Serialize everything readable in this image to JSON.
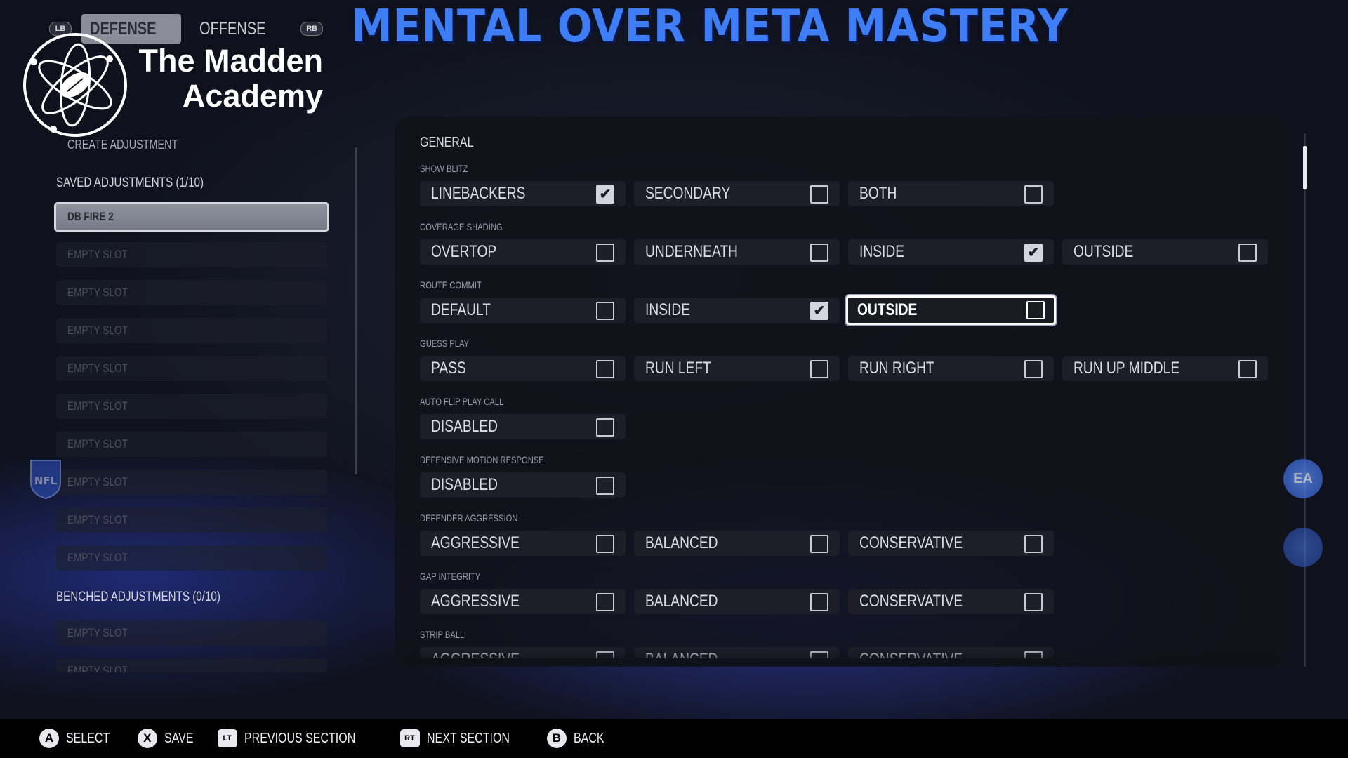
{
  "banner": "MENTAL OVER META MASTERY",
  "tabs": {
    "lb": "LB",
    "defense": "DEFENSE",
    "offense": "OFFENSE",
    "rb": "RB"
  },
  "brand": {
    "line1": "The Madden",
    "line2": "Academy"
  },
  "left": {
    "create": "CREATE ADJUSTMENT",
    "saved_title": "SAVED ADJUSTMENTS (1/10)",
    "saved": [
      "DB FIRE 2",
      "EMPTY SLOT",
      "EMPTY SLOT",
      "EMPTY SLOT",
      "EMPTY SLOT",
      "EMPTY SLOT",
      "EMPTY SLOT",
      "EMPTY SLOT",
      "EMPTY SLOT",
      "EMPTY SLOT"
    ],
    "benched_title": "BENCHED ADJUSTMENTS (0/10)",
    "benched": [
      "EMPTY SLOT",
      "EMPTY SLOT"
    ]
  },
  "main": {
    "section": "GENERAL",
    "groups": [
      {
        "title": "SHOW BLITZ",
        "options": [
          {
            "label": "LINEBACKERS",
            "checked": true
          },
          {
            "label": "SECONDARY",
            "checked": false
          },
          {
            "label": "BOTH",
            "checked": false
          }
        ]
      },
      {
        "title": "COVERAGE SHADING",
        "options": [
          {
            "label": "OVERTOP",
            "checked": false
          },
          {
            "label": "UNDERNEATH",
            "checked": false
          },
          {
            "label": "INSIDE",
            "checked": true
          },
          {
            "label": "OUTSIDE",
            "checked": false
          }
        ]
      },
      {
        "title": "ROUTE COMMIT",
        "options": [
          {
            "label": "DEFAULT",
            "checked": false
          },
          {
            "label": "INSIDE",
            "checked": true
          },
          {
            "label": "OUTSIDE",
            "checked": false,
            "focused": true
          }
        ]
      },
      {
        "title": "GUESS PLAY",
        "options": [
          {
            "label": "PASS",
            "checked": false
          },
          {
            "label": "RUN LEFT",
            "checked": false
          },
          {
            "label": "RUN RIGHT",
            "checked": false
          },
          {
            "label": "RUN UP MIDDLE",
            "checked": false
          }
        ]
      },
      {
        "title": "AUTO FLIP PLAY CALL",
        "options": [
          {
            "label": "DISABLED",
            "checked": false
          }
        ]
      },
      {
        "title": "DEFENSIVE MOTION RESPONSE",
        "options": [
          {
            "label": "DISABLED",
            "checked": false
          }
        ]
      },
      {
        "title": "DEFENDER AGGRESSION",
        "options": [
          {
            "label": "AGGRESSIVE",
            "checked": false
          },
          {
            "label": "BALANCED",
            "checked": false
          },
          {
            "label": "CONSERVATIVE",
            "checked": false
          }
        ]
      },
      {
        "title": "GAP INTEGRITY",
        "options": [
          {
            "label": "AGGRESSIVE",
            "checked": false
          },
          {
            "label": "BALANCED",
            "checked": false
          },
          {
            "label": "CONSERVATIVE",
            "checked": false
          }
        ]
      },
      {
        "title": "STRIP BALL",
        "options": [
          {
            "label": "AGGRESSIVE",
            "checked": false
          },
          {
            "label": "BALANCED",
            "checked": false
          },
          {
            "label": "CONSERVATIVE",
            "checked": false
          }
        ]
      }
    ]
  },
  "footer": [
    {
      "button": "A",
      "label": "SELECT"
    },
    {
      "button": "X",
      "label": "SAVE"
    },
    {
      "button": "LT",
      "label": "PREVIOUS SECTION"
    },
    {
      "button": "RT",
      "label": "NEXT SECTION"
    },
    {
      "button": "B",
      "label": "BACK"
    }
  ],
  "colors": {
    "banner": "#3f7df5",
    "panel": "#101118",
    "accent_glow": "#3c50e6"
  },
  "icons": {
    "logo": "atom-football-logo",
    "ea": "ea-sports-icon",
    "nfl": "nfl-shield-icon"
  }
}
